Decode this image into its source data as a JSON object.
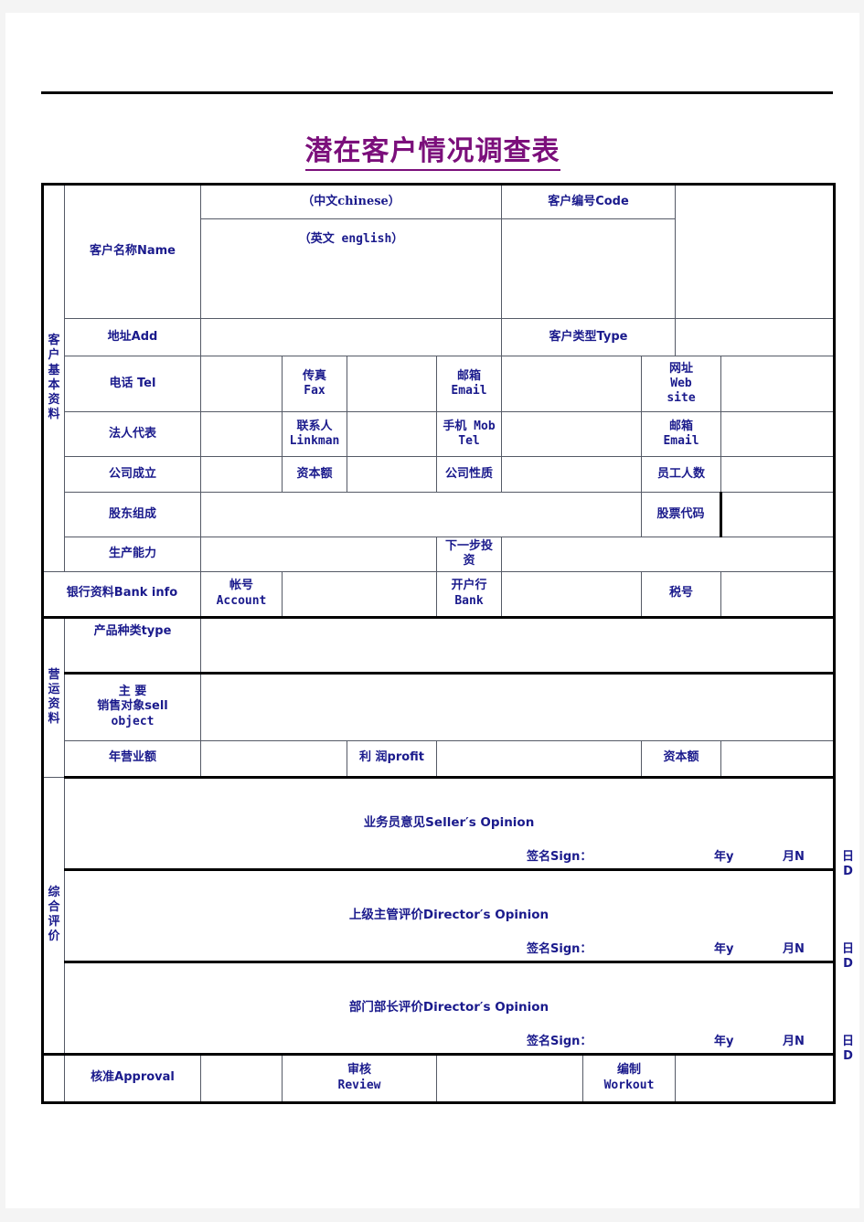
{
  "document": {
    "title": "潜在客户情况调查表",
    "title_color": "#7b0f7b",
    "text_color": "#1a1a8c"
  },
  "sections": {
    "basic": {
      "side_label": "客户基本资料"
    },
    "operations": {
      "side_label": "营运资料"
    },
    "evaluation": {
      "side_label": "综合评价"
    }
  },
  "basic_info": {
    "name_label": "客户名称Name",
    "chinese_hint": "（中文chinese）",
    "english_hint": "（英文 english）",
    "code_label": "客户编号Code",
    "address_label": "地址Add",
    "type_label": "客户类型Type",
    "tel_label": "电话    Tel",
    "fax_label_cn": "传真",
    "fax_label_en": "Fax",
    "email_label_cn": "邮箱",
    "email_label_en": "Email",
    "website_label_cn": "网址",
    "website_label_en1": "Web",
    "website_label_en2": "site",
    "legal_rep_label": "法人代表",
    "linkman_label_cn": "联系人",
    "linkman_label_en": "Linkman",
    "mobile_label_cn": "手机 Mob",
    "mobile_label_en": "Tel",
    "email2_label_cn": "邮箱",
    "email2_label_en": "Email",
    "founded_label": "公司成立",
    "capital_label": "资本额",
    "nature_label": "公司性质",
    "employees_label": "员工人数",
    "shareholders_label": "股东组成",
    "stock_code_label": "股票代码",
    "capacity_label": "生产能力",
    "next_investment_label": "下一步投资",
    "bank_info_label": "银行资料Bank info",
    "account_label_cn": "帐号",
    "account_label_en": "Account",
    "bank_label_cn": "开户行",
    "bank_label_en": "Bank",
    "tax_no_label": "税号"
  },
  "operations_info": {
    "product_type_label": "产品种类type",
    "sell_object_label_l1": "主    要",
    "sell_object_label_l2": "销售对象sell",
    "sell_object_label_l3": "object",
    "annual_turnover_label": "年营业额",
    "profit_label": "利 润profit",
    "capital_label": "资本额"
  },
  "evaluation_info": {
    "seller_opinion_label": "业务员意见Seller′s Opinion",
    "director_opinion_label": "上级主管评价Director′s Opinion",
    "department_opinion_label": "部门部长评价Director′s Opinion",
    "sign_label": "签名Sign：",
    "year_label": "年y",
    "month_label": "月N",
    "day_label": "日D",
    "approval_label": "核准Approval",
    "review_label_cn": "审核",
    "review_label_en": "Review",
    "workout_label_cn": "编制",
    "workout_label_en": "Workout"
  }
}
